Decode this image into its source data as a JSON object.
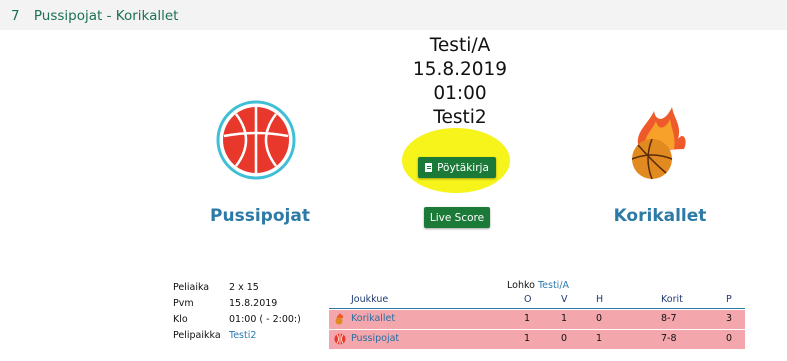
{
  "header": {
    "number": "7",
    "title": "Pussipojat - Korikallet"
  },
  "game": {
    "group": "Testi/A",
    "date": "15.8.2019",
    "time": "01:00",
    "venue": "Testi2"
  },
  "buttons": {
    "poytakirja": "Pöytäkirja",
    "live_score": "Live Score"
  },
  "teams": {
    "home": "Pussipojat",
    "away": "Korikallet"
  },
  "details": [
    {
      "label": "Peliaika",
      "value": "2 x 15"
    },
    {
      "label": "Pvm",
      "value": "15.8.2019"
    },
    {
      "label": "Klo",
      "value": "01:00 ( - 2:00:)"
    },
    {
      "label": "Pelipaikka",
      "value": "Testi2"
    }
  ],
  "standings": {
    "lohko_label": "Lohko",
    "lohko_value": "Testi/A",
    "columns": [
      "Joukkue",
      "O",
      "V",
      "H",
      "Korit",
      "P"
    ],
    "rows": [
      {
        "team": "Korikallet",
        "o": "1",
        "v": "1",
        "h": "0",
        "korit": "8-7",
        "p": "3"
      },
      {
        "team": "Pussipojat",
        "o": "1",
        "v": "0",
        "h": "1",
        "korit": "7-8",
        "p": "0"
      }
    ]
  },
  "colors": {
    "accent_green": "#1c7a39",
    "team_blue": "#2d7aa6",
    "highlight_yellow": "#f6f30f",
    "row_pink": "#f4a6ad"
  }
}
